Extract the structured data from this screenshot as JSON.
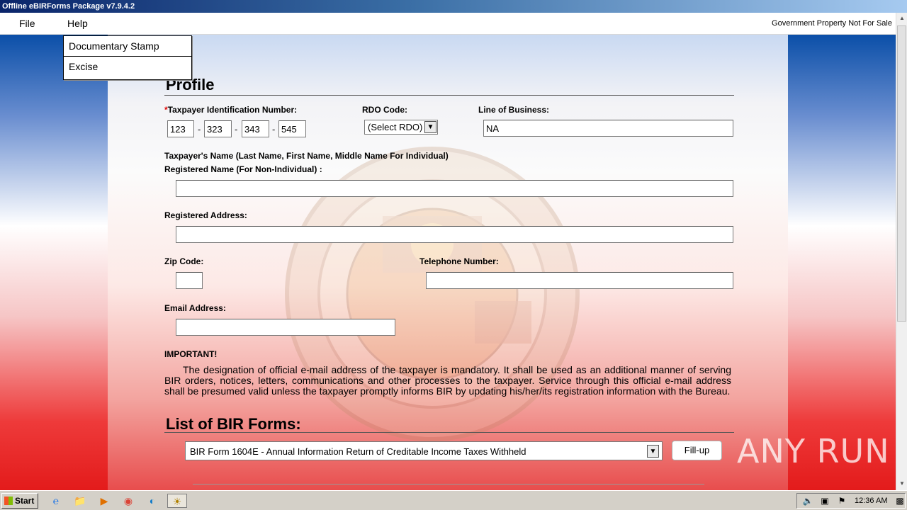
{
  "window": {
    "title": "Offline eBIRForms Package v7.9.4.2"
  },
  "menubar": {
    "file": "File",
    "help": "Help",
    "notice": "Government Property Not For Sale"
  },
  "dropdown": {
    "items": [
      "Documentary Stamp",
      "Excise"
    ]
  },
  "profile": {
    "heading": "Profile",
    "required_mark": "*",
    "tin_label": "Taxpayer Identification Number:",
    "tin": [
      "123",
      "323",
      "343",
      "545"
    ],
    "tin_sep": "-",
    "rdo_label": "RDO Code:",
    "rdo_value": "(Select RDO)",
    "lob_label": "Line of Business:",
    "lob_value": "NA",
    "name_label_1": "Taxpayer's Name (Last Name, First Name, Middle Name For Individual)",
    "name_label_2": "Registered Name (For Non-Individual) :",
    "name_value": "",
    "address_label": "Registered Address:",
    "address_value": "",
    "zip_label": "Zip Code:",
    "zip_value": "",
    "phone_label": "Telephone Number:",
    "phone_value": "",
    "email_label": "Email Address:",
    "email_value": "",
    "important_title": "IMPORTANT!",
    "important_text": "The designation of official e-mail address of the taxpayer is mandatory. It shall be used as an additional manner of serving BIR orders, notices, letters, communications and other processes to the taxpayer. Service through this official e-mail address shall be presumed valid unless the taxpayer promptly informs BIR by updating his/her/its registration information with the Bureau."
  },
  "forms": {
    "heading": "List of BIR Forms:",
    "selected": "BIR Form 1604E - Annual Information Return of Creditable Income Taxes Withheld",
    "fillup_label": "Fill-up"
  },
  "taskbar": {
    "start_label": "Start",
    "clock": "12:36 AM"
  },
  "watermark": "ANY RUN",
  "colors": {
    "title_bar": "#0a246a",
    "required": "#dd0000",
    "bg_bottom": "#e31b1b",
    "bg_top": "#0b4fa8"
  }
}
